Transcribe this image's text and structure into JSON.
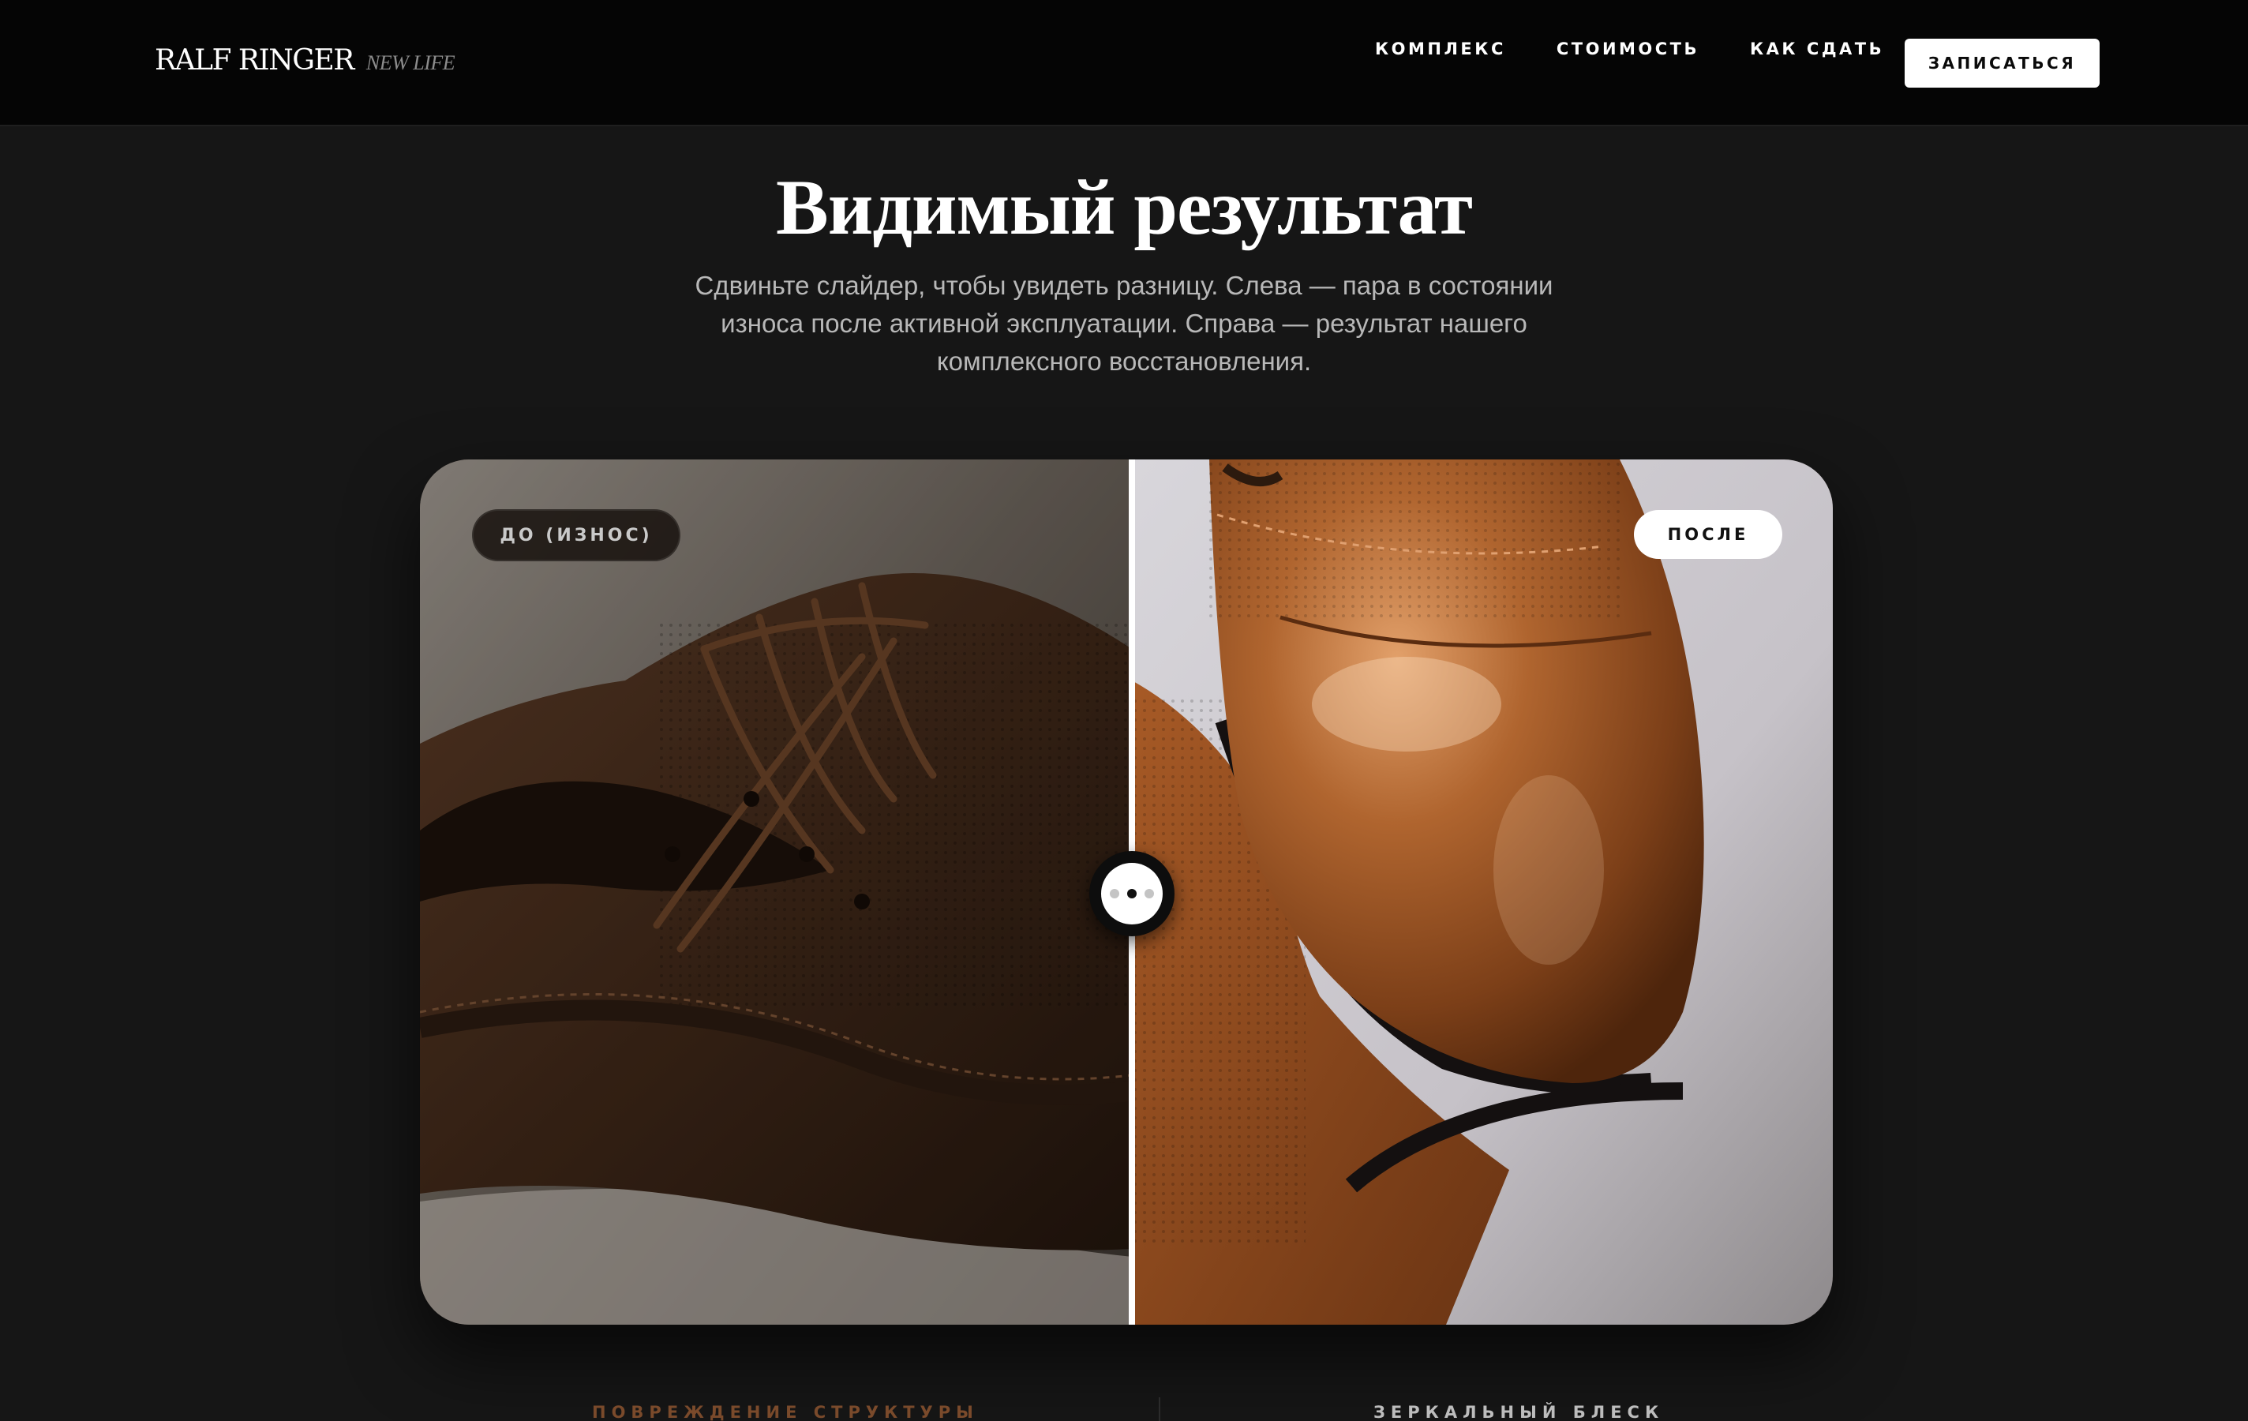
{
  "header": {
    "logo_main": "RALF RINGER",
    "logo_sub": "NEW LIFE",
    "nav": [
      "КОМПЛЕКС",
      "СТОИМОСТЬ",
      "КАК СДАТЬ"
    ],
    "cta_label": "ЗАПИСАТЬСЯ"
  },
  "intro": {
    "title": "Видимый результат",
    "lead": "Сдвиньте слайдер, чтобы увидеть разницу. Слева — пара в состоянии износа после активной эксплуатации. Справа — результат нашего комплексного восстановления."
  },
  "compare": {
    "before_label": "ДО (ИЗНОС)",
    "after_label": "ПОСЛЕ",
    "slider_position": 0.503
  },
  "bottom": {
    "left_label": "ПОВРЕЖДЕНИЕ СТРУКТУРЫ",
    "right_label": "ЗЕРКАЛЬНЫЙ БЛЕСК"
  },
  "colors": {
    "page_bg": "#161616",
    "header_bg": "#050505",
    "accent_brown": "#7a4a2b"
  }
}
